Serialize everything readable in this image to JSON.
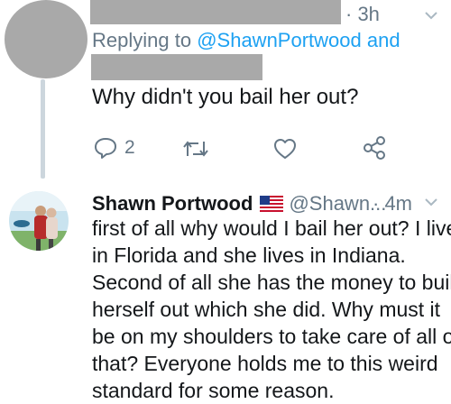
{
  "tweet1": {
    "time": "· 3h",
    "replying_prefix": "Replying to",
    "replying_handle": "@ShawnPortwood and",
    "text": "Why didn't you bail her out?",
    "reply_count": "2"
  },
  "tweet2": {
    "author_name": "Shawn Portwood",
    "handle": "@Shawn...",
    "time": "· 4m",
    "lines": [
      "first of all why would I bail her out? I live",
      "in Florida and she lives in Indiana.",
      "Second of all she has the money to build",
      "herself out which she did. Why must it",
      "be on my shoulders to take care of all of",
      "that? Everyone holds me to this weird",
      "standard for some reason."
    ]
  },
  "colors": {
    "accent": "#1da1f2",
    "muted": "#657786",
    "redaction": "#a9a9a9",
    "thread_line": "#ccd6dd"
  },
  "icons": [
    "reply-icon",
    "retweet-icon",
    "like-icon",
    "share-icon",
    "chevron-down-icon",
    "us-flag-icon"
  ]
}
